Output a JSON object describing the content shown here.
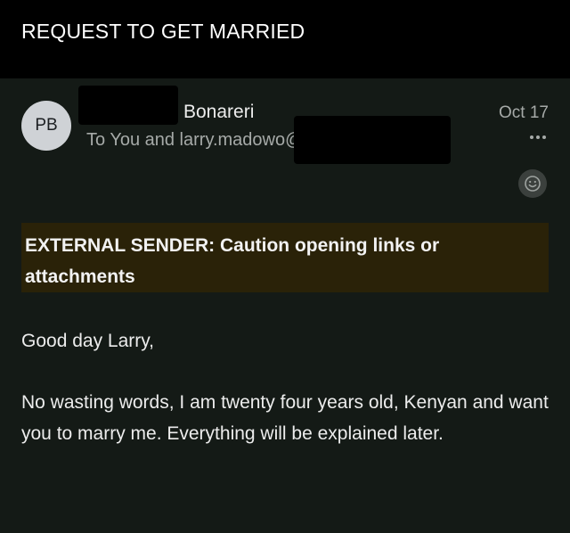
{
  "header": {
    "subject": "REQUEST TO GET MARRIED"
  },
  "message": {
    "avatar_initials": "PB",
    "sender_name": "Bonareri",
    "recipients": "To You and larry.madowo@",
    "date": "Oct 17",
    "more_icon": "ellipsis-icon",
    "reaction_icon": "smiley-icon",
    "banner": "EXTERNAL SENDER: Caution opening links or attachments",
    "greeting": "Good day Larry,",
    "paragraph": "No wasting words, I am twenty four years old, Kenyan and want you to marry me.  Everything will be explained later."
  },
  "colors": {
    "background": "#141a16",
    "header": "#000000",
    "banner": "#2a2208",
    "avatar": "#cfd2d6",
    "secondary_text": "#a6aaa8"
  }
}
